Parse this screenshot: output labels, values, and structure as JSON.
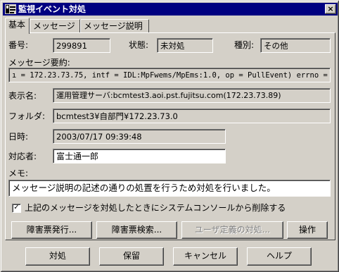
{
  "window": {
    "title": "監視イベント対処",
    "close_symbol": "×"
  },
  "tabs": [
    {
      "label": "基本",
      "active": true
    },
    {
      "label": "メッセージ",
      "active": false
    },
    {
      "label": "メッセージ説明",
      "active": false
    }
  ],
  "basic": {
    "number_label": "番号:",
    "number_value": "299891",
    "status_label": "状態:",
    "status_value": "未対処",
    "type_label": "種別:",
    "type_value": "その他",
    "summary_label": "メッセージ要約:",
    "summary_value": "ı = 172.23.73.75, intf = IDL:MpFwems/MpEms:1.0, op = PullEvent) errno = 2.",
    "display_name_label": "表示名:",
    "display_name_value": "運用管理サーバ:bcmtest3.aoi.pst.fujitsu.com(172.23.73.89)",
    "folder_label": "フォルダ:",
    "folder_value": "bcmtest3¥自部門¥172.23.73.0",
    "datetime_label": "日時:",
    "datetime_value": "2003/07/17 09:39:48",
    "responder_label": "対応者:",
    "responder_value": "富士通一郎",
    "memo_label": "メモ:",
    "memo_value": "メッセージ説明の記述の通りの処置を行うため対処を行いました。",
    "delete_checkbox_label": "上記のメッセージを対処したときにシステムコンソールから削除する",
    "delete_checkbox_checked": true,
    "delete_checkbox_mark": "✓"
  },
  "panel_buttons": {
    "issue": "障害票発行...",
    "search": "障害票検索...",
    "user_defined": "ユーザ定義の対処...",
    "operation": "操作"
  },
  "footer_buttons": {
    "handle": "対処",
    "hold": "保留",
    "cancel": "キャンセル",
    "help": "ヘルプ"
  },
  "colors": {
    "titlebar": "#000080",
    "face": "#d4d0c8",
    "field_white": "#ffffff"
  }
}
